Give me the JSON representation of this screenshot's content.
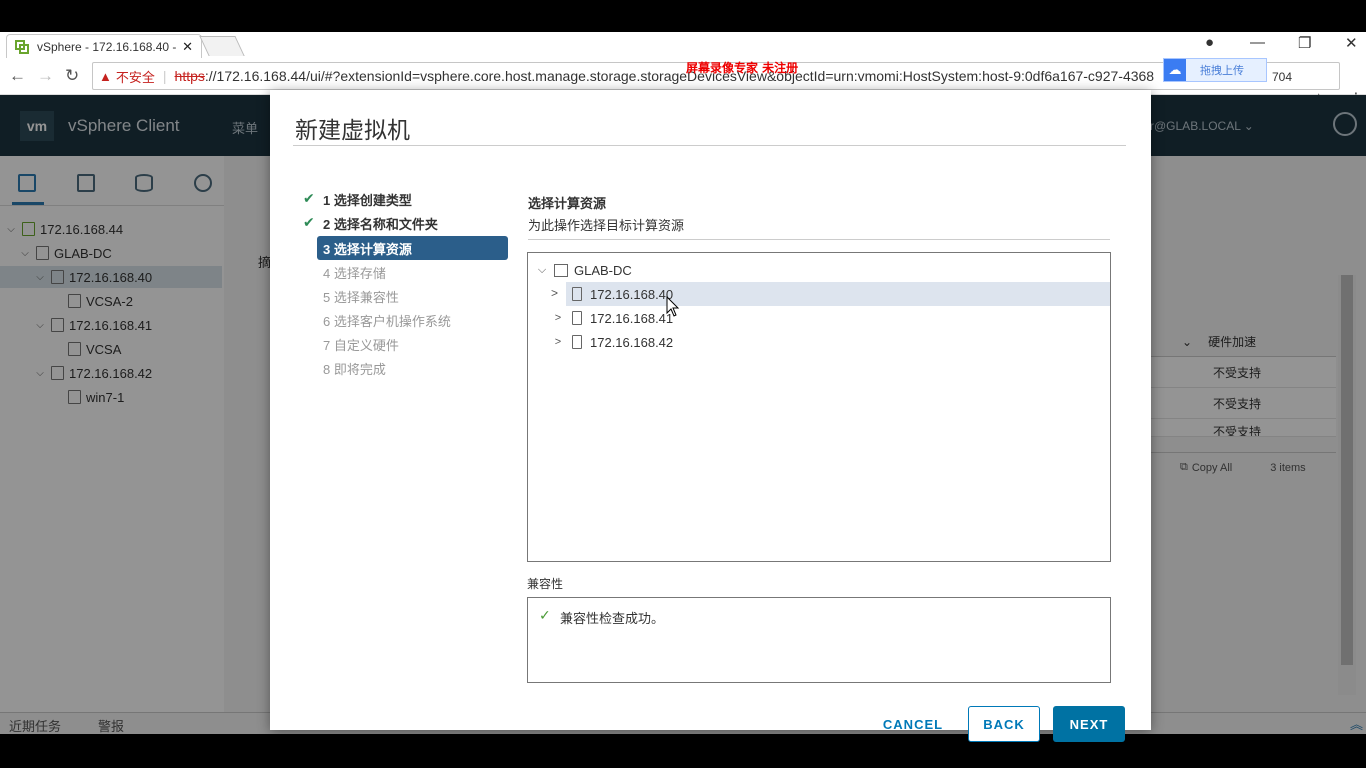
{
  "browser": {
    "tab_title": "vSphere - 172.16.168.40 -",
    "not_secure": "不安全",
    "url_scheme": "https",
    "url_rest": "://172.16.168.44/ui/#?extensionId=vsphere.core.host.manage.storage.storageDevicesView&objectId=urn:vmomi:HostSystem:host-9:0df6a167-c927-4368",
    "url_tail": "704"
  },
  "overlay_text": {
    "recorder_watermark": "屏幕录像专家  未注册",
    "cloud_button": "拖拽上传"
  },
  "header": {
    "logo": "vm",
    "product": "vSphere Client",
    "menu": "菜单",
    "user": "r@GLAB.LOCAL"
  },
  "inventory": {
    "items": [
      {
        "label": "172.16.168.44",
        "level": 0
      },
      {
        "label": "GLAB-DC",
        "level": 1
      },
      {
        "label": "172.16.168.40",
        "level": 2,
        "selected": true
      },
      {
        "label": "VCSA-2",
        "level": 3
      },
      {
        "label": "172.16.168.41",
        "level": 2
      },
      {
        "label": "VCSA",
        "level": 3
      },
      {
        "label": "172.16.168.42",
        "level": 2
      },
      {
        "label": "win7-1",
        "level": 3
      }
    ]
  },
  "background_panel": {
    "col_header": "硬件加速",
    "rows": [
      "不受支持",
      "不受支持",
      "不受支持"
    ],
    "copy_all": "Copy All",
    "count": "3 items",
    "partial_label": "摘"
  },
  "bottom_bar": {
    "recent_tasks": "近期任务",
    "alarms": "警报"
  },
  "dialog": {
    "title": "新建虚拟机",
    "steps": [
      {
        "label": "1 选择创建类型",
        "state": "done"
      },
      {
        "label": "2 选择名称和文件夹",
        "state": "done"
      },
      {
        "label": "3 选择计算资源",
        "state": "active"
      },
      {
        "label": "4 选择存储",
        "state": "pending"
      },
      {
        "label": "5 选择兼容性",
        "state": "pending"
      },
      {
        "label": "6 选择客户机操作系统",
        "state": "pending"
      },
      {
        "label": "7 自定义硬件",
        "state": "pending"
      },
      {
        "label": "8 即将完成",
        "state": "pending"
      }
    ],
    "section_title": "选择计算资源",
    "section_subtitle": "为此操作选择目标计算资源",
    "tree": {
      "root": "GLAB-DC",
      "hosts": [
        "172.16.168.40",
        "172.16.168.41",
        "172.16.168.42"
      ]
    },
    "compat_label": "兼容性",
    "compat_message": "兼容性检查成功。",
    "buttons": {
      "cancel": "CANCEL",
      "back": "BACK",
      "next": "NEXT"
    }
  },
  "colors": {
    "header_bg": "#1d3441",
    "active_step": "#2b5e8a",
    "primary_button": "#0072a3",
    "link_blue": "#0079b8",
    "success_green": "#4a9a35"
  }
}
